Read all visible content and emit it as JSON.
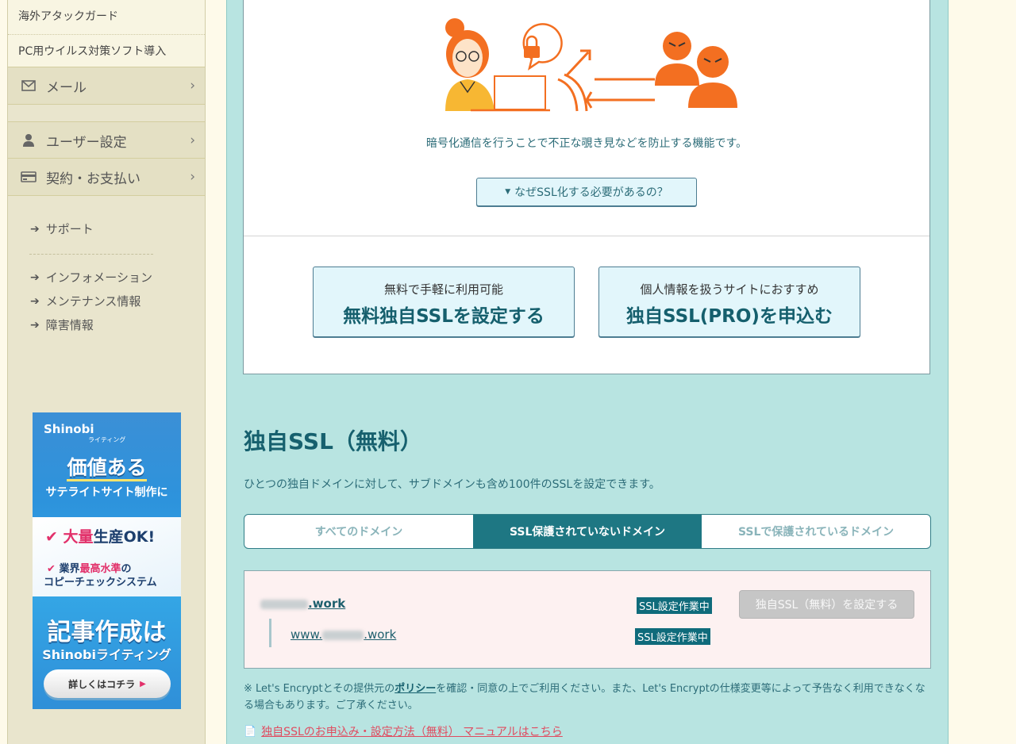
{
  "sidebar": {
    "sub_items": [
      "海外アタックガード",
      "PC用ウイルス対策ソフト導入"
    ],
    "main_items": [
      {
        "label": "メール",
        "icon": "mail-icon"
      },
      {
        "label": "ユーザー設定",
        "icon": "user-icon"
      },
      {
        "label": "契約・お支払い",
        "icon": "credit-card-icon"
      }
    ],
    "links": [
      "サポート",
      "インフォメーション",
      "メンテナンス情報",
      "障害情報"
    ]
  },
  "banner": {
    "logo": "Shinobi",
    "logo_sub": "ライティング",
    "headline": "価値ある",
    "subline": "サテライトサイト制作に",
    "point1_check": "✔",
    "point1_a": "大量",
    "point1_b": "生産OK!",
    "point2_check": "✔",
    "point2_a": "業界",
    "point2_b": "最高水準",
    "point2_c": "の",
    "point2_d": "コピーチェックシステム",
    "big1": "記事作成は",
    "big2": "Shinobiライティング",
    "cta": "詳しくはコチラ"
  },
  "main": {
    "description": "暗号化通信を行うことで不正な覗き見などを防止する機能です。",
    "why_button": "なぜSSL化する必要があるの？",
    "free_button": {
      "small": "無料で手軽に利用可能",
      "large": "無料独自SSLを設定する"
    },
    "pro_button": {
      "small": "個人情報を扱うサイトにおすすめ",
      "large": "独自SSL(PRO)を申込む"
    },
    "section_title": "独自SSL（無料）",
    "section_desc": "ひとつの独自ドメインに対して、サブドメインも含め100件のSSLを設定できます。",
    "tabs": [
      {
        "label": "すべてのドメイン",
        "active": false
      },
      {
        "label": "SSL保護されていないドメイン",
        "active": true
      },
      {
        "label": "SSLで保護されているドメイン",
        "active": false
      }
    ],
    "domains": [
      {
        "prefix": "",
        "suffix": ".work",
        "status": "SSL設定作業中"
      },
      {
        "prefix": "www.",
        "suffix": ".work",
        "status": "SSL設定作業中"
      }
    ],
    "set_button": "独自SSL（無料）を設定する",
    "note_before": "※ Let's Encryptとその提供元の",
    "note_link": "ポリシー",
    "note_after": "を確認・同意の上でご利用ください。また、Let's Encryptの仕様変更等によって予告なく利用できなくなる場合もあります。ご了承ください。",
    "manual_link": "独自SSLのお申込み・設定方法（無料） マニュアルはこちら"
  },
  "colors": {
    "accent": "#1e7783",
    "main_bg": "#b8e4e1",
    "sidebar_bg": "#e9e5cd",
    "illustration_orange": "#f36f21",
    "illustration_yellow": "#f7b733"
  }
}
